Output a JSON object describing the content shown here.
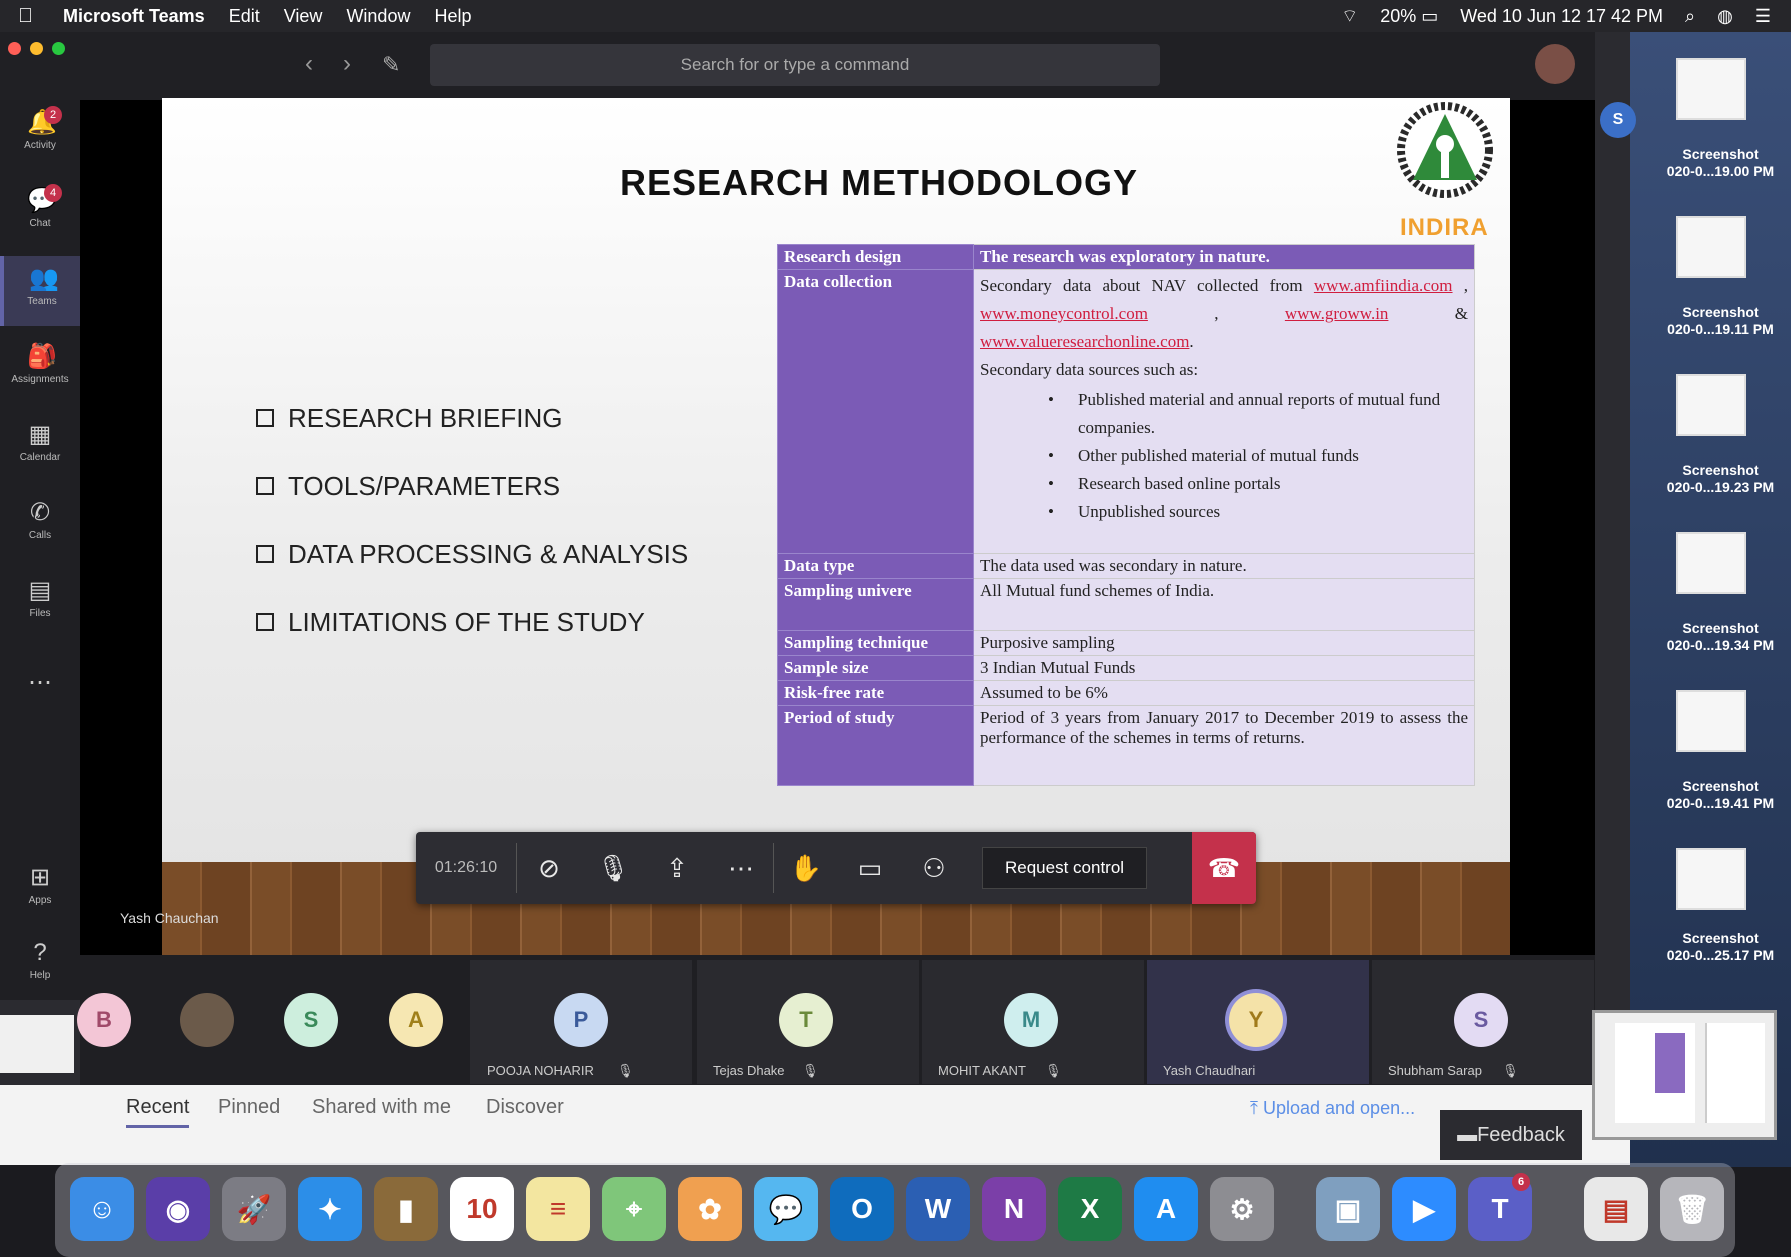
{
  "menubar": {
    "app_name": "Microsoft Teams",
    "menus": [
      "Edit",
      "View",
      "Window",
      "Help"
    ],
    "battery": "20%",
    "clock": "Wed 10 Jun  12 17 42 PM"
  },
  "search": {
    "placeholder": "Search for or type a command"
  },
  "rail": [
    {
      "label": "Activity",
      "icon": "bell-icon",
      "badge": "2"
    },
    {
      "label": "Chat",
      "icon": "chat-icon",
      "badge": "4"
    },
    {
      "label": "Teams",
      "icon": "teams-icon",
      "active": true
    },
    {
      "label": "Assignments",
      "icon": "bag-icon"
    },
    {
      "label": "Calendar",
      "icon": "calendar-icon"
    },
    {
      "label": "Calls",
      "icon": "phone-icon"
    },
    {
      "label": "Files",
      "icon": "file-icon"
    },
    {
      "label": "...",
      "icon": "more-icon"
    },
    {
      "label": "Apps",
      "icon": "apps-icon"
    },
    {
      "label": "Help",
      "icon": "help-icon"
    }
  ],
  "slide": {
    "title": "RESEARCH METHODOLOGY",
    "logo_text": "INDIRA",
    "bullets": [
      "RESEARCH BRIEFING",
      "TOOLS/PARAMETERS",
      "DATA PROCESSING & ANALYSIS",
      "LIMITATIONS OF THE STUDY"
    ],
    "table": {
      "research_design": {
        "k": "Research design",
        "v": "The research was exploratory in nature."
      },
      "data_collection": {
        "k": "Data collection",
        "intro": "Secondary data about NAV collected from",
        "link1": "www.amfiindia.com",
        "link2": "www.moneycontrol.com",
        "link3": "www.groww.in",
        "amp": "&",
        "link4": "www.valueresearchonline.com",
        "sources_intro": "Secondary data sources such as:",
        "sources": [
          "Published material and annual reports of mutual fund companies.",
          "Other published material of mutual funds",
          "Research based online portals",
          "Unpublished sources"
        ]
      },
      "data_type": {
        "k": "Data type",
        "v": "The data used was secondary in nature."
      },
      "sampling_universe": {
        "k": "Sampling univere",
        "v": "All Mutual fund schemes of India."
      },
      "sampling_technique": {
        "k": "Sampling technique",
        "v": "Purposive sampling"
      },
      "sample_size": {
        "k": "Sample size",
        "v": "3 Indian Mutual Funds"
      },
      "risk_free": {
        "k": "Risk-free rate",
        "v": "Assumed to be 6%"
      },
      "period": {
        "k": "Period of study",
        "v": "Period of 3 years from January 2017 to December 2019 to assess the performance of the schemes in terms of returns."
      }
    }
  },
  "presenter": "Yash Chauchan",
  "callbar": {
    "timer": "01:26:10",
    "request_control": "Request control"
  },
  "participants": {
    "small": [
      {
        "initial": "B",
        "color": "#f3c6d6"
      },
      {
        "initial": "",
        "color": "#6b5a4a"
      },
      {
        "initial": "S",
        "color": "#cdeedd"
      },
      {
        "initial": "A",
        "color": "#f6e7b2"
      }
    ],
    "tiles": [
      {
        "initial": "P",
        "name": "POOJA NOHARIR",
        "color": "#c8d9f2"
      },
      {
        "initial": "T",
        "name": "Tejas Dhake",
        "color": "#e6efd1"
      },
      {
        "initial": "M",
        "name": "MOHIT AKANT",
        "color": "#cfeeee"
      },
      {
        "initial": "Y",
        "name": "Yash Chaudhari",
        "color": "#f4e2a8"
      },
      {
        "initial": "S",
        "name": "Shubham Sarap",
        "color": "#e3dbf3"
      }
    ]
  },
  "files": {
    "tabs": [
      "Recent",
      "Pinned",
      "Shared with me",
      "Discover"
    ],
    "upload": "Upload and open...",
    "feedback": "Feedback"
  },
  "desktop": {
    "screenshots": [
      {
        "l1": "Screenshot",
        "l2": "020-0...19.00 PM"
      },
      {
        "l1": "Screenshot",
        "l2": "020-0...19.11 PM"
      },
      {
        "l1": "Screenshot",
        "l2": "020-0...19.23 PM"
      },
      {
        "l1": "Screenshot",
        "l2": "020-0...19.34 PM"
      },
      {
        "l1": "Screenshot",
        "l2": "020-0...19.41 PM"
      },
      {
        "l1": "Screenshot",
        "l2": "020-0...25.17 PM"
      }
    ],
    "avatar_initial": "S"
  },
  "dock": {
    "apps": [
      {
        "name": "finder-icon",
        "glyph": "☺",
        "color": "#3b8de6"
      },
      {
        "name": "siri-icon",
        "glyph": "◉",
        "color": "#5a3ea8"
      },
      {
        "name": "launchpad-icon",
        "glyph": "🚀",
        "color": "#7c7c84"
      },
      {
        "name": "safari-icon",
        "glyph": "✦",
        "color": "#2c8ee8"
      },
      {
        "name": "notes-book-icon",
        "glyph": "▮",
        "color": "#8a6a3a"
      },
      {
        "name": "calendar-icon",
        "glyph": "10",
        "color": "#ffffff"
      },
      {
        "name": "notes-icon",
        "glyph": "≡",
        "color": "#f3e6a0"
      },
      {
        "name": "maps-icon",
        "glyph": "⌖",
        "color": "#7fc67a"
      },
      {
        "name": "photos-icon",
        "glyph": "✿",
        "color": "#f0a050"
      },
      {
        "name": "messages-icon",
        "glyph": "💬",
        "color": "#55b7f0"
      },
      {
        "name": "outlook-icon",
        "glyph": "O",
        "color": "#0f6cbd"
      },
      {
        "name": "word-icon",
        "glyph": "W",
        "color": "#2b5fb3"
      },
      {
        "name": "onenote-icon",
        "glyph": "N",
        "color": "#7b3fa8"
      },
      {
        "name": "excel-icon",
        "glyph": "X",
        "color": "#1e7a45"
      },
      {
        "name": "appstore-icon",
        "glyph": "A",
        "color": "#1f8df0"
      },
      {
        "name": "settings-icon",
        "glyph": "⚙",
        "color": "#8d8d92"
      },
      {
        "name": "preview-icon",
        "glyph": "▣",
        "color": "#7f9fbf"
      },
      {
        "name": "zoom-icon",
        "glyph": "▶",
        "color": "#2d8cff"
      },
      {
        "name": "teams-icon",
        "glyph": "T",
        "color": "#5b5fc7",
        "badge": "6"
      },
      {
        "name": "document-icon",
        "glyph": "▤",
        "color": "#e8e8e8"
      },
      {
        "name": "trash-icon",
        "glyph": "🗑",
        "color": "#b6b6bb"
      }
    ]
  }
}
